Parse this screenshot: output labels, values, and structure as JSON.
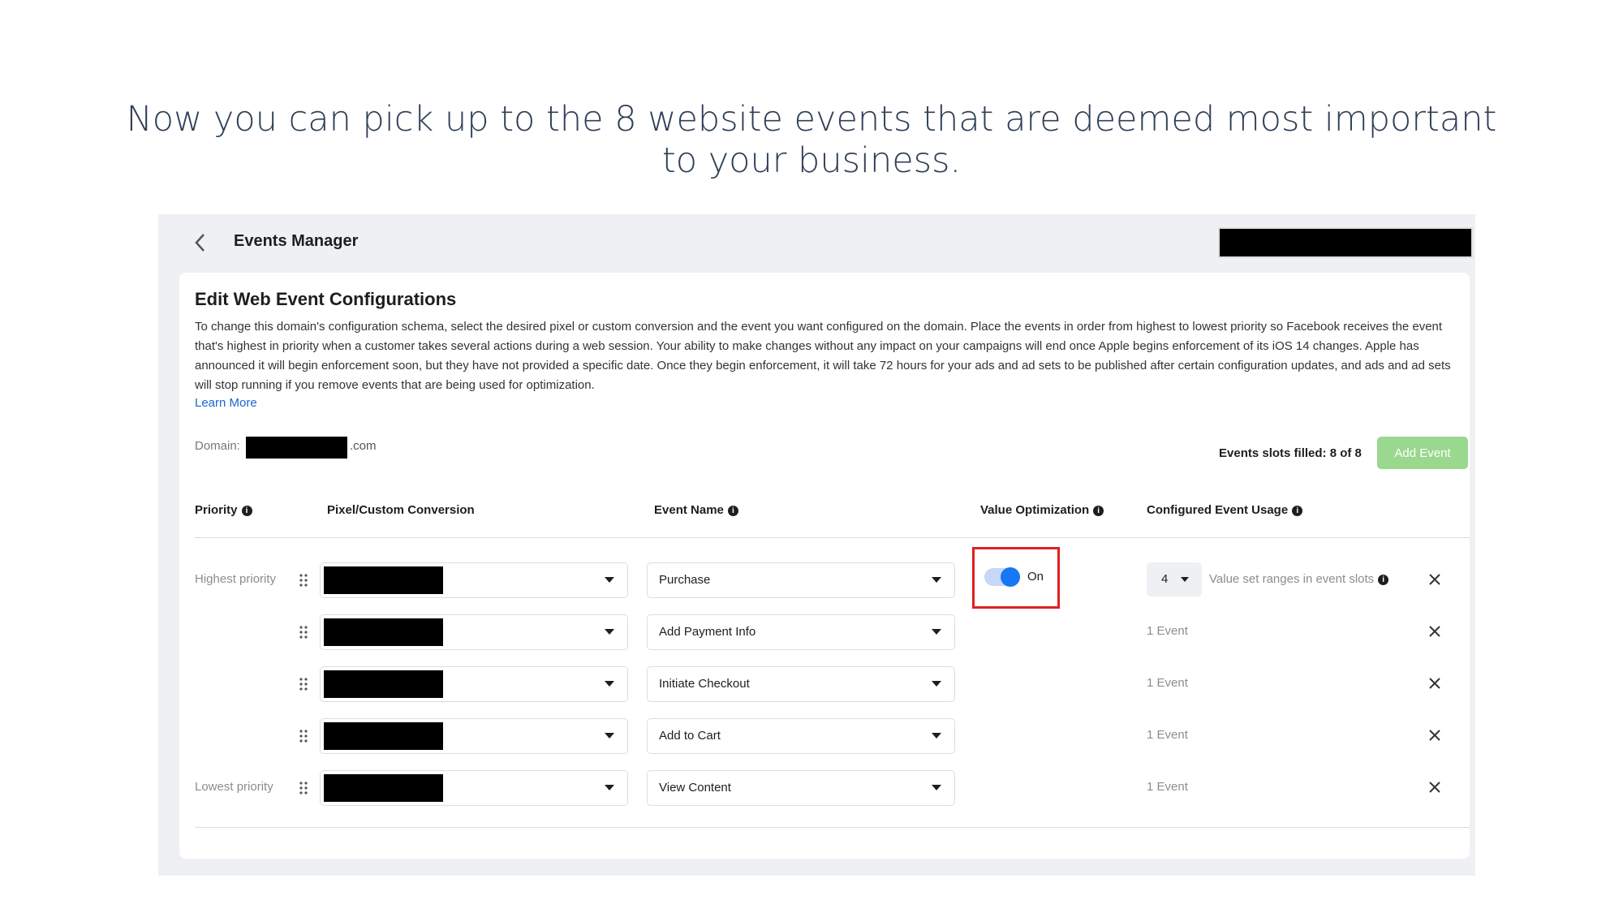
{
  "slide": {
    "title": "Now you can pick up to the 8 website events that are deemed most important to your business."
  },
  "app": {
    "title": "Events Manager"
  },
  "card": {
    "title": "Edit Web Event Configurations",
    "description": "To change this domain's configuration schema, select the desired pixel or custom conversion and the event you want configured on the domain. Place the events in order from highest to lowest priority so Facebook receives the event that's highest in priority when a customer takes several actions during a web session. Your ability to make changes without any impact on your campaigns will end once Apple begins enforcement of its iOS 14 changes. Apple has announced it will begin enforcement soon, but they have not provided a specific date. Once they begin enforcement, it will take 72 hours for your ads and ad sets to be published after certain configuration updates, and ads and ad sets will stop running if you remove events that are being used for optimization.",
    "learn_more": "Learn More",
    "domain_label": "Domain:",
    "domain_suffix": ".com",
    "slots_filled": "Events slots filled: 8 of 8",
    "add_event": "Add Event"
  },
  "columns": {
    "priority": "Priority",
    "pixel": "Pixel/Custom Conversion",
    "event_name": "Event Name",
    "value_opt": "Value Optimization",
    "usage": "Configured Event Usage"
  },
  "rows": [
    {
      "priority": "Highest priority",
      "event": "Purchase",
      "usage": ""
    },
    {
      "priority": "",
      "event": "Add Payment Info",
      "usage": "1 Event"
    },
    {
      "priority": "",
      "event": "Initiate Checkout",
      "usage": "1 Event"
    },
    {
      "priority": "",
      "event": "Add to Cart",
      "usage": "1 Event"
    },
    {
      "priority": "Lowest priority",
      "event": "View Content",
      "usage": "1 Event"
    }
  ],
  "value_optimization": {
    "toggle_label": "On",
    "toggle_on": true,
    "slots_value": "4",
    "range_text": "Value set ranges in event slots"
  },
  "colors": {
    "accent": "#1877f2",
    "add_event_bg": "#9bd88f",
    "highlight_border": "#e02020",
    "link": "#1a66d2"
  }
}
